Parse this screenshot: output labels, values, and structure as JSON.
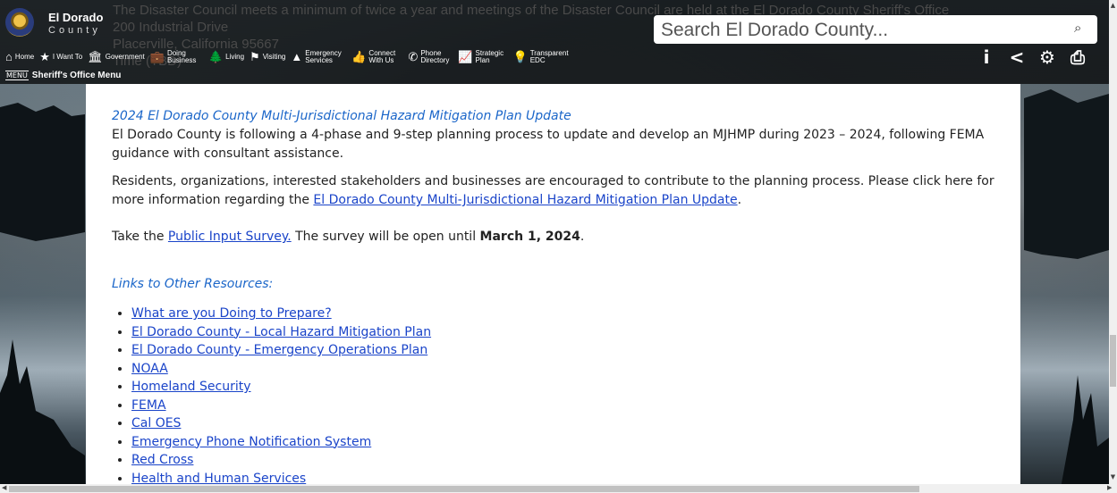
{
  "background_overlay": [
    "The Disaster Council meets a minimum of twice a year and meetings of the Disaster Council are held at the El Dorado County Sheriff's Office",
    "200 Industrial Drive",
    "Placerville, California 95667",
    "Time (TBD)"
  ],
  "brand": {
    "line1": "El Dorado",
    "line2": "County"
  },
  "search": {
    "placeholder": "Search El Dorado County...",
    "icon": "search-icon"
  },
  "nav": [
    {
      "icon": "home-icon",
      "glyph": "⌂",
      "label": "Home"
    },
    {
      "icon": "star-icon",
      "glyph": "★",
      "label": "I Want To"
    },
    {
      "icon": "building-icon",
      "glyph": "🏛",
      "label": "Government"
    },
    {
      "icon": "briefcase-icon",
      "glyph": "💼",
      "label": "Doing Business"
    },
    {
      "icon": "tree-icon",
      "glyph": "🌲",
      "label": "Living"
    },
    {
      "icon": "signpost-icon",
      "glyph": "⚑",
      "label": "Visiting"
    },
    {
      "icon": "warning-icon",
      "glyph": "▲",
      "label": "Emergency Services"
    },
    {
      "icon": "thumbs-up-icon",
      "glyph": "👍",
      "label": "Connect With Us"
    },
    {
      "icon": "phone-icon",
      "glyph": "✆",
      "label": "Phone Directory"
    },
    {
      "icon": "chart-icon",
      "glyph": "📈",
      "label": "Strategic Plan"
    },
    {
      "icon": "lightbulb-icon",
      "glyph": "💡",
      "label": "Transparent EDC"
    }
  ],
  "tools": [
    {
      "icon": "info-icon",
      "glyph": "i"
    },
    {
      "icon": "share-icon",
      "glyph": "<"
    },
    {
      "icon": "gear-icon",
      "glyph": "⚙"
    },
    {
      "icon": "print-icon",
      "glyph": "⎙"
    }
  ],
  "menu": {
    "word": "MENU",
    "label": "Sheriff's Office Menu"
  },
  "content": {
    "subhead1": "2024 El Dorado County Multi-Jurisdictional Hazard Mitigation Plan Update",
    "para1": "El Dorado County is following a 4-phase and 9-step planning process to update and develop an MJHMP during 2023 – 2024, following FEMA guidance with consultant assistance.",
    "para2_pre": "Residents, organizations, interested stakeholders and businesses are encouraged to contribute to the planning process. Please click here for more information regarding the ",
    "para2_link": "El Dorado County Multi-Jurisdictional Hazard Mitigation Plan Update",
    "para2_post": ".",
    "para3_pre": "Take the ",
    "para3_link": "Public Input Survey.",
    "para3_mid": " The survey will be open until ",
    "para3_bold": "March 1, 2024",
    "para3_post": ".",
    "subhead2": "Links to Other Resources:",
    "links": [
      "What are you Doing to Prepare?",
      "El Dorado County - Local Hazard Mitigation Plan",
      "El Dorado County - Emergency Operations Plan",
      "NOAA",
      "Homeland Security",
      "FEMA",
      "Cal OES",
      "Emergency Phone Notification System",
      "Red Cross",
      "Health and Human Services"
    ]
  }
}
